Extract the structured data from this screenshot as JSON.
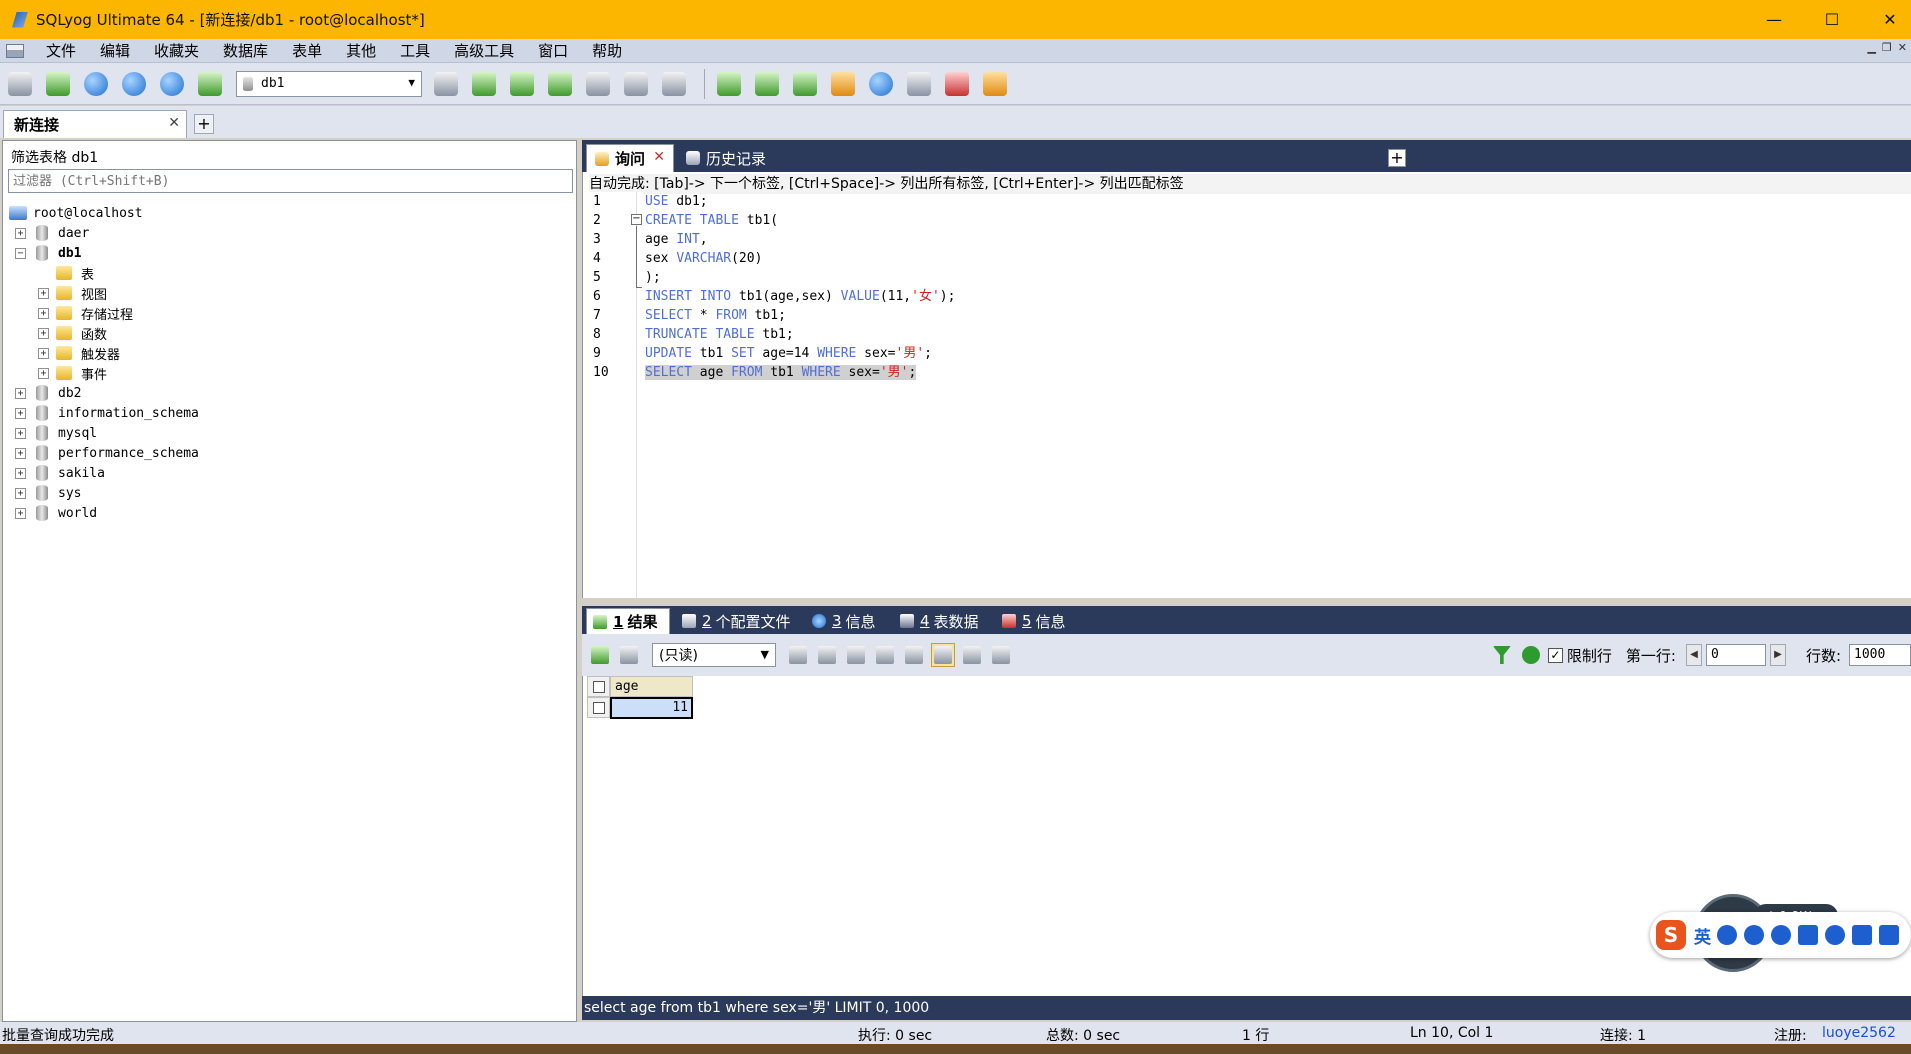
{
  "window": {
    "title": "SQLyog Ultimate 64 - [新连接/db1 - root@localhost*]",
    "minimize": "—",
    "maximize": "☐",
    "close": "✕"
  },
  "menu": {
    "items": [
      "文件",
      "编辑",
      "收藏夹",
      "数据库",
      "表单",
      "其他",
      "工具",
      "高级工具",
      "窗口",
      "帮助"
    ]
  },
  "toolbar": {
    "database_select": "db1"
  },
  "connection_tab": {
    "label": "新连接",
    "close": "✕",
    "add": "+"
  },
  "left_panel": {
    "filter_label": "筛选表格 db1",
    "filter_placeholder": "过滤器 (Ctrl+Shift+B)",
    "tree": {
      "root": "root@localhost",
      "databases_before": [
        "daer"
      ],
      "active_db": "db1",
      "active_db_children": [
        "表",
        "视图",
        "存储过程",
        "函数",
        "触发器",
        "事件"
      ],
      "databases_after": [
        "db2",
        "information_schema",
        "mysql",
        "performance_schema",
        "sakila",
        "sys",
        "world"
      ]
    }
  },
  "query_tabs": {
    "active": "询问",
    "history": "历史记录",
    "close": "✕",
    "add": "+"
  },
  "editor": {
    "autocomplete_hint": "自动完成: [Tab]-> 下一个标签, [Ctrl+Space]-> 列出所有标签, [Ctrl+Enter]-> 列出匹配标签",
    "line_numbers": [
      "1",
      "2",
      "3",
      "4",
      "5",
      "6",
      "7",
      "8",
      "9",
      "10"
    ]
  },
  "result_tabs": [
    {
      "num": "1",
      "label": "结果"
    },
    {
      "num": "2",
      "label": "个配置文件"
    },
    {
      "num": "3",
      "label": "信息"
    },
    {
      "num": "4",
      "label": "表数据"
    },
    {
      "num": "5",
      "label": "信息"
    }
  ],
  "result_toolbar": {
    "mode_select": "(只读)",
    "limit_label": "限制行",
    "limit_checked": "✓",
    "first_row_label": "第一行:",
    "first_row_value": "0",
    "rows_label": "行数:",
    "rows_value": "1000"
  },
  "result_grid": {
    "column": "age",
    "value": "11"
  },
  "query_status": "select age from tb1 where sex='男' LIMIT 0, 1000",
  "statusbar": {
    "left": "批量查询成功完成",
    "exec": "执行: 0 sec",
    "total": "总数: 0 sec",
    "rows": "1 行",
    "cursor": "Ln 10, Col 1",
    "connections": "连接: 1",
    "register_label": "注册:",
    "register_user": "luoye2562"
  },
  "ime": {
    "logo": "S",
    "lang": "英",
    "net_speed": "↑ 1.8K/s"
  },
  "colors": {
    "titlebar": "#fdb600",
    "dark_strip": "#2b3a5a",
    "keyword": "#4f6fd8",
    "string": "#d42020"
  }
}
